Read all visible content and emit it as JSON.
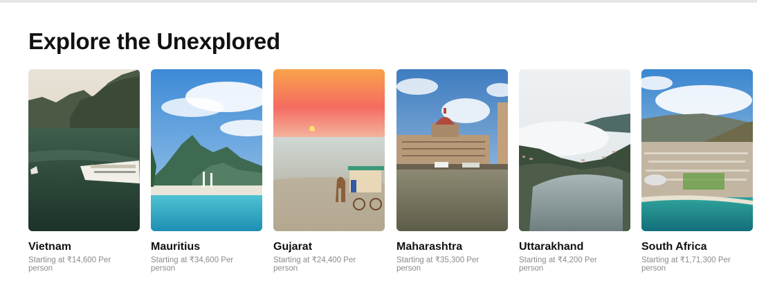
{
  "section": {
    "title": "Explore the Unexplored"
  },
  "destinations": [
    {
      "name": "Vietnam",
      "price": "Starting at ₹14,600 Per person",
      "image_icon": "vietnam-bay-cruise-image"
    },
    {
      "name": "Mauritius",
      "price": "Starting at ₹34,600 Per person",
      "image_icon": "mauritius-beach-mountain-image"
    },
    {
      "name": "Gujarat",
      "price": "Starting at ₹24,400 Per person",
      "image_icon": "gujarat-sunset-camel-cart-image"
    },
    {
      "name": "Maharashtra",
      "price": "Starting at ₹35,300 Per person",
      "image_icon": "mumbai-taj-hotel-image"
    },
    {
      "name": "Uttarakhand",
      "price": "Starting at ₹4,200 Per person",
      "image_icon": "nainital-lake-clouds-image"
    },
    {
      "name": "South Africa",
      "price": "Starting at ₹1,71,300 Per person",
      "image_icon": "cape-town-table-mountain-image"
    }
  ]
}
